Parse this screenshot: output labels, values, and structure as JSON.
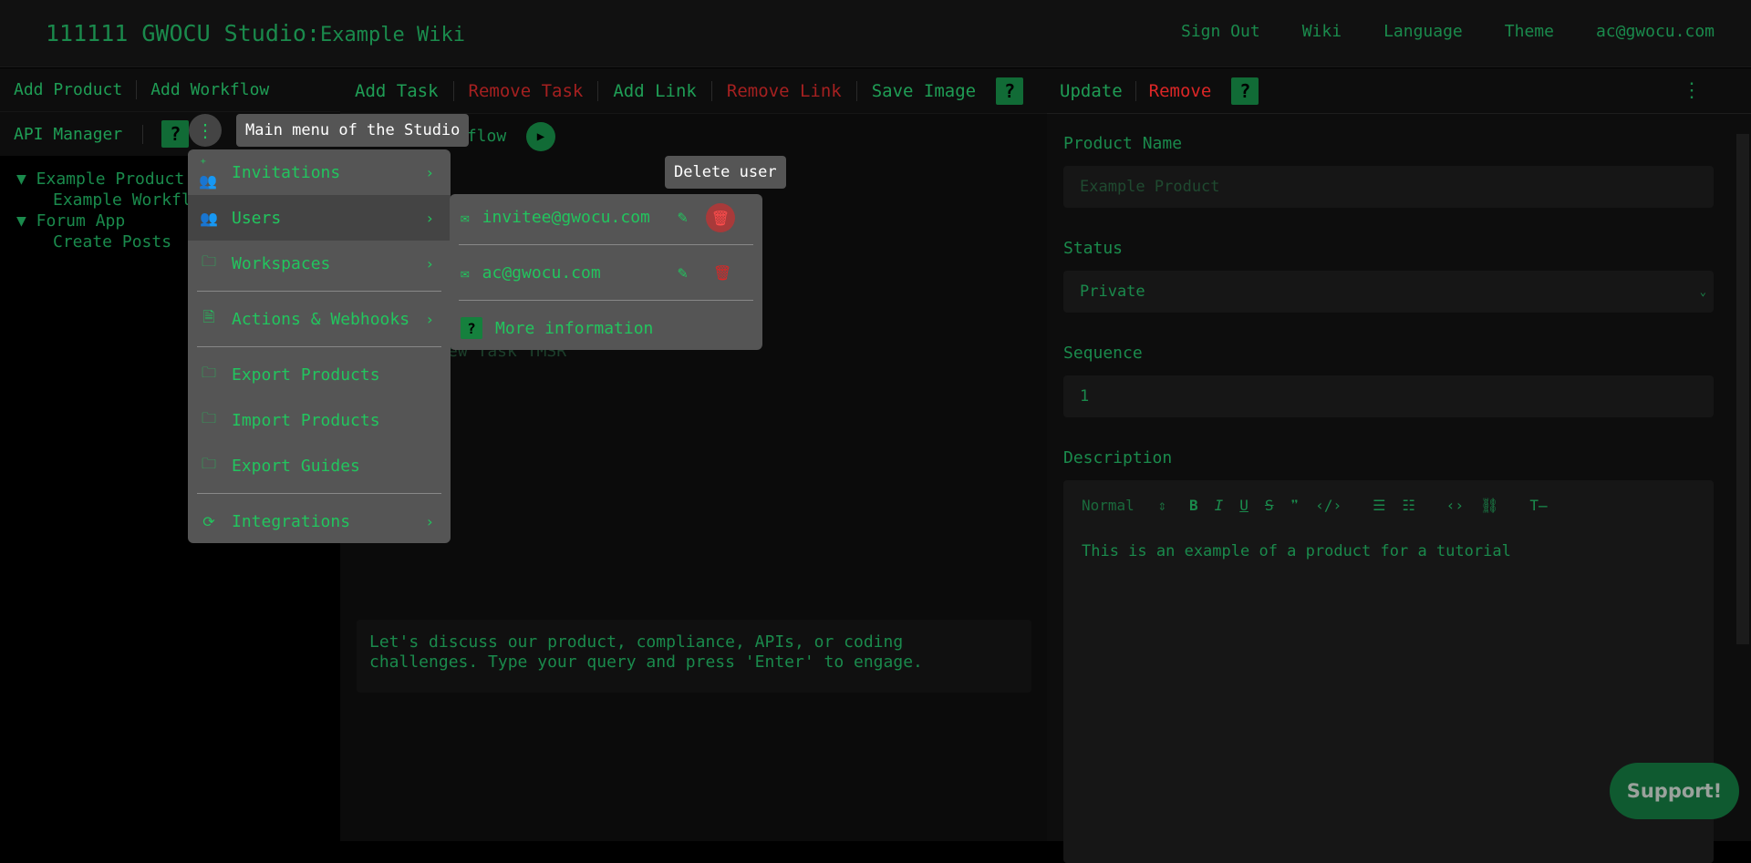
{
  "header": {
    "title_main": "111111 GWOCU Studio:",
    "title_sub": "Example Wiki",
    "nav": [
      "Sign Out",
      "Wiki",
      "Language",
      "Theme",
      "ac@gwocu.com"
    ]
  },
  "left": {
    "toolbar1": [
      "Add Product",
      "Add Workflow"
    ],
    "toolbar2": [
      "API Manager"
    ],
    "help": "?",
    "tree": {
      "product1": "▼ Example Product",
      "workflow1": "Example Workflow",
      "product2": "▼ Forum App",
      "workflow2": "Create Posts"
    }
  },
  "center": {
    "toolbar": [
      "Add Task",
      "Remove Task",
      "Add Link",
      "Remove Link",
      "Save Image"
    ],
    "help": "?",
    "workflow_label": "kflow",
    "task_label": "ew Task TMSR",
    "chat_text": "Let's discuss our product, compliance, APIs, or coding challenges. Type your query and press 'Enter' to engage."
  },
  "right": {
    "toolbar": [
      "Update",
      "Remove"
    ],
    "help": "?",
    "fields": {
      "name_label": "Product Name",
      "name_placeholder": "Example Product",
      "status_label": "Status",
      "status_value": "Private",
      "sequence_label": "Sequence",
      "sequence_value": "1",
      "description_label": "Description",
      "editor_format": "Normal",
      "description_text": "This is an example of a product for a tutorial"
    }
  },
  "main_menu": {
    "tooltip": "Main menu of the Studio",
    "items": {
      "invitations": "Invitations",
      "users": "Users",
      "workspaces": "Workspaces",
      "actions": "Actions & Webhooks",
      "export_products": "Export Products",
      "import_products": "Import Products",
      "export_guides": "Export Guides",
      "integrations": "Integrations"
    }
  },
  "users_menu": {
    "tooltip": "Delete user",
    "users": [
      "invitee@gwocu.com",
      "ac@gwocu.com"
    ],
    "more": "More information",
    "more_icon": "?"
  },
  "support": "Support!",
  "colors": {
    "accent": "#22c55e",
    "danger": "#dc2626",
    "menu_bg": "#555555"
  }
}
